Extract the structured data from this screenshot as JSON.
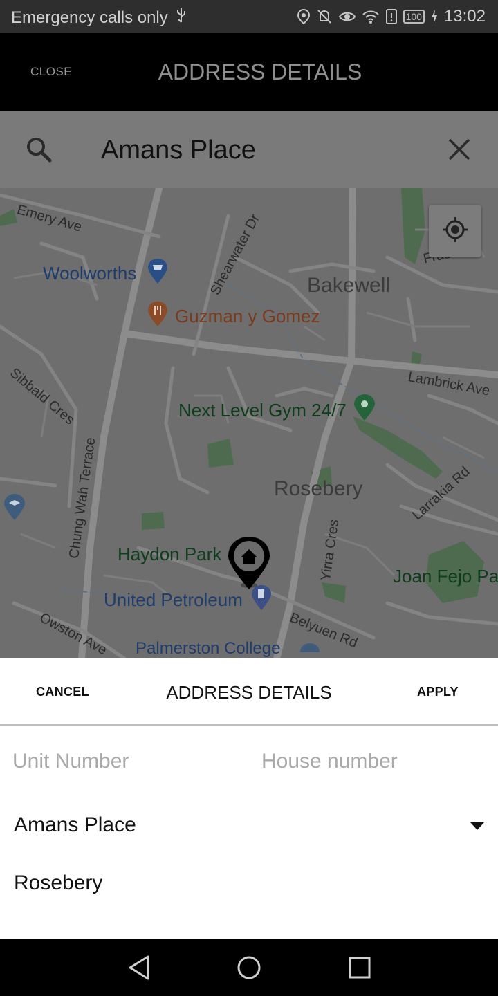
{
  "status_bar": {
    "carrier_text": "Emergency calls only",
    "battery": "100",
    "time": "13:02"
  },
  "app_bar": {
    "close_label": "CLOSE",
    "title": "ADDRESS DETAILS"
  },
  "search": {
    "query": "Amans Place"
  },
  "map": {
    "roads": [
      "Emery Ave",
      "Shearwater Dr",
      "Sibbald Cres",
      "Lambrick Ave",
      "Chung Wah Terrace",
      "Larrakia Rd",
      "Yirra Cres",
      "Owston Ave",
      "Belyuen Rd",
      "Fraser Ct"
    ],
    "places": {
      "woolworths": "Woolworths",
      "guzman": "Guzman y Gomez",
      "gym": "Next Level Gym 24/7",
      "haydon_park": "Haydon Park",
      "united_petroleum": "United Petroleum",
      "palmerston_college": "Palmerston College",
      "joan_fejo": "Joan Fejo Par"
    },
    "suburbs": [
      "Bakewell",
      "Rosebery"
    ]
  },
  "sheet": {
    "cancel_label": "CANCEL",
    "title": "ADDRESS DETAILS",
    "apply_label": "APPLY",
    "unit_placeholder": "Unit Number",
    "house_placeholder": "House number",
    "street": "Amans Place",
    "suburb": "Rosebery"
  },
  "colors": {
    "status_bar_bg": "#2e2e2e",
    "app_bar_bg": "#000000",
    "map_overlay": "#6e6e6e",
    "sheet_bg": "#ffffff"
  }
}
